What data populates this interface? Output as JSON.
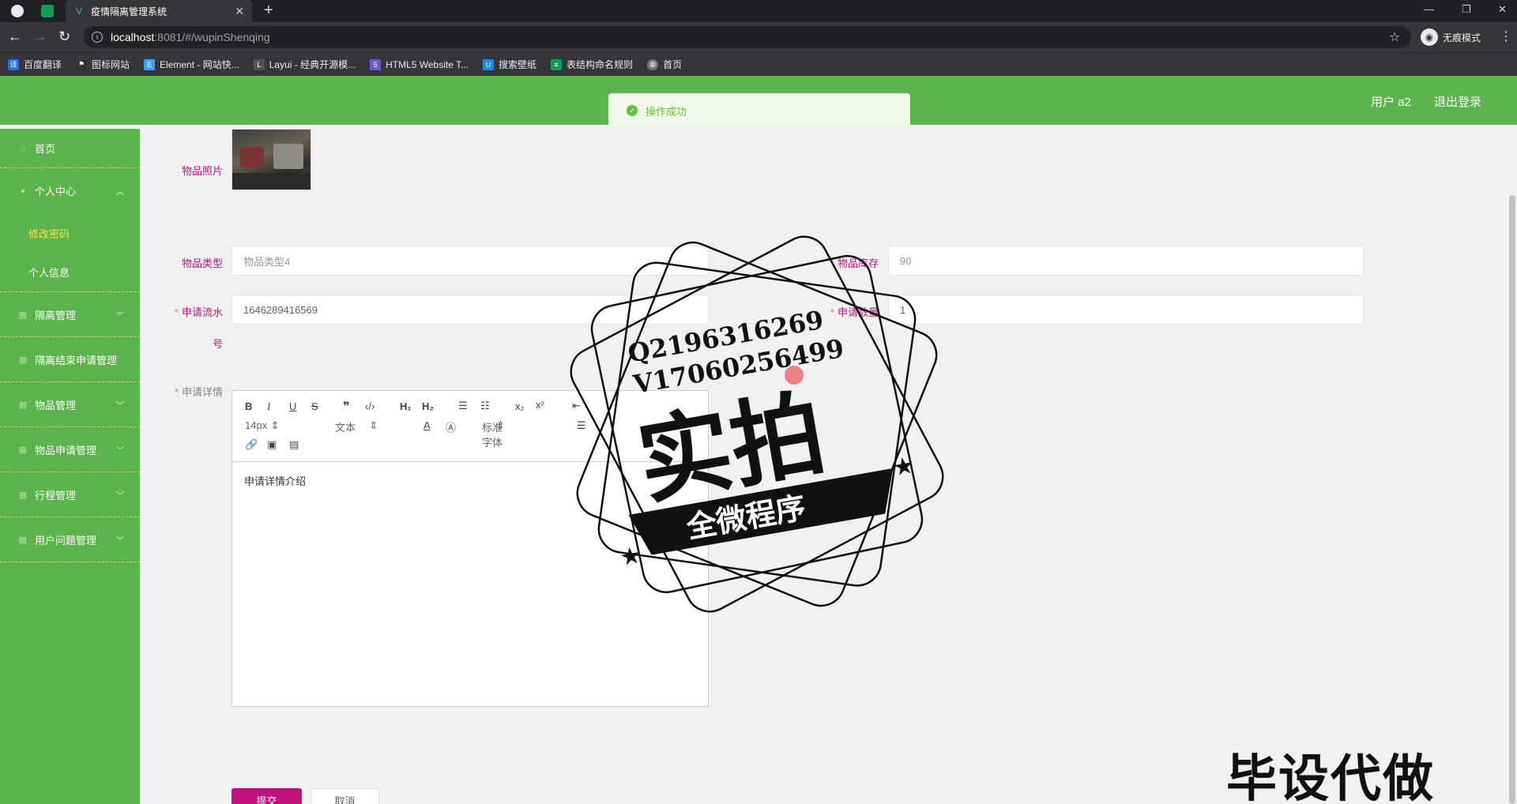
{
  "browser": {
    "tab_title": "疫情隔离管理系统",
    "tab_close": "✕",
    "new_tab": "+",
    "url_host": "localhost",
    "url_path": ":8081/#/wupinShenqing",
    "incognito_label": "无痕模式",
    "bookmarks": [
      {
        "label": "百度翻译",
        "color": "#1a73e8"
      },
      {
        "label": "图标网站",
        "color": "#333333"
      },
      {
        "label": "Element - 网站快...",
        "color": "#409eff"
      },
      {
        "label": "Layui - 经典开源模...",
        "color": "#555555"
      },
      {
        "label": "HTML5 Website T...",
        "color": "#6a5acd"
      },
      {
        "label": "搜索壁纸",
        "color": "#1e88e5"
      },
      {
        "label": "表结构命名规则",
        "color": "#0f9d58"
      },
      {
        "label": "首页",
        "color": "#777777"
      }
    ]
  },
  "header": {
    "user_label": "用户 a2",
    "logout_label": "退出登录",
    "bg_color": "#5bb54c"
  },
  "toast": {
    "message": "操作成功"
  },
  "sidebar": {
    "items": [
      {
        "label": "首页",
        "icon": "home-icon"
      },
      {
        "label": "个人中心",
        "icon": "user-icon",
        "expanded": true,
        "children": [
          {
            "label": "修改密码",
            "active": true
          },
          {
            "label": "个人信息",
            "active": false
          }
        ]
      },
      {
        "label": "隔离管理",
        "icon": "list-icon"
      },
      {
        "label": "隔离结束申请管理",
        "icon": "list-icon"
      },
      {
        "label": "物品管理",
        "icon": "list-icon"
      },
      {
        "label": "物品申请管理",
        "icon": "list-icon"
      },
      {
        "label": "行程管理",
        "icon": "list-icon"
      },
      {
        "label": "用户问题管理",
        "icon": "list-icon"
      }
    ]
  },
  "form": {
    "photo_label": "物品照片",
    "type_label": "物品类型",
    "type_value": "物品类型4",
    "stock_label": "物品库存",
    "stock_value": "90",
    "serial_label": "申请流水",
    "serial_label_cont": "号",
    "serial_value": "1646289416569",
    "qty_label": "申请数量",
    "qty_value": "1",
    "detail_label": "申请详情",
    "editor": {
      "font_size": "14px",
      "text_type": "文本",
      "font_family": "标准字体",
      "content": "申请详情介绍"
    },
    "submit_label": "提交",
    "cancel_label": "取消"
  },
  "watermark": {
    "line1": "Q2196316269",
    "line2": "V17060256499",
    "big": "实拍",
    "ribbon": "全微程序",
    "corner": "毕设代做"
  }
}
